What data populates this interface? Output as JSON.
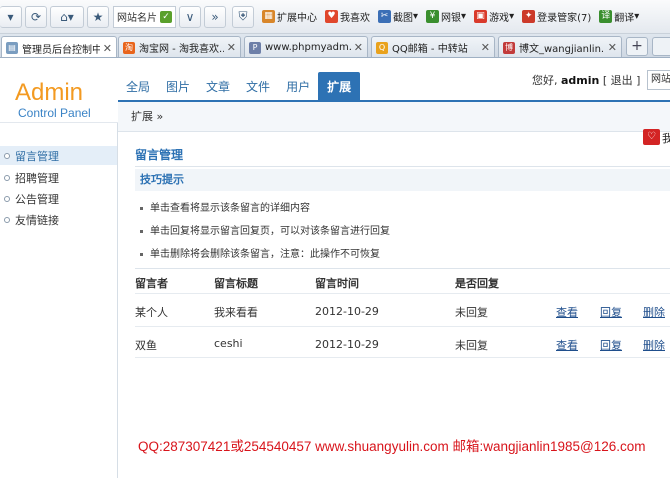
{
  "browser": {
    "address_label": "网站名片",
    "toolbar_links": [
      {
        "label": "扩展中心",
        "icon": "extension-center-icon",
        "color": "#d8862a"
      },
      {
        "label": "我喜欢",
        "icon": "heart-icon",
        "color": "#e0472c"
      },
      {
        "label": "截图",
        "icon": "screenshot-icon",
        "color": "#3b6fb6"
      },
      {
        "label": "网银",
        "icon": "bank-icon",
        "color": "#3a8f2e"
      },
      {
        "label": "游戏",
        "icon": "game-icon",
        "color": "#d93a2b"
      },
      {
        "label": "登录管家(7)",
        "icon": "login-manager-icon",
        "color": "#cc3a2a"
      },
      {
        "label": "翻译",
        "icon": "translate-icon",
        "color": "#3a8f2e"
      }
    ],
    "tabs": [
      {
        "label": "管理员后台控制中...",
        "active": true
      },
      {
        "label": "淘宝网 - 淘我喜欢..."
      },
      {
        "label": "www.phpmyadm..."
      },
      {
        "label": "QQ邮箱 - 中转站"
      },
      {
        "label": "博文_wangjianlin..."
      }
    ],
    "new_tab": "+",
    "right_input": "网站"
  },
  "admin": {
    "logo_main": "Admin",
    "logo_sub": "Control Panel",
    "nav": [
      "全局",
      "图片",
      "文章",
      "文件",
      "用户",
      "扩展"
    ],
    "active_nav": "扩展",
    "user_greeting": "您好,",
    "username": "admin",
    "logout_open": "[",
    "logout": "退出",
    "logout_close": "]",
    "breadcrumb": "扩展 »",
    "sidebar": [
      "留言管理",
      "招聘管理",
      "公告管理",
      "友情链接"
    ],
    "love_badge": "♡",
    "love_text": "我"
  },
  "main": {
    "title": "留言管理",
    "tips_heading": "技巧提示",
    "tips": [
      "单击查看将显示该条留言的详细内容",
      "单击回复将显示留言回复页，可以对该条留言进行回复",
      "单击删除将会删除该条留言，注意：此操作不可恢复"
    ],
    "table": {
      "headers": [
        "留言者",
        "留言标题",
        "留言时间",
        "是否回复"
      ],
      "rows": [
        {
          "author": "某个人",
          "title": "我来看看",
          "date": "2012-10-29",
          "replied": "未回复"
        },
        {
          "author": "双鱼",
          "title": "ceshi",
          "date": "2012-10-29",
          "replied": "未回复"
        }
      ],
      "actions": [
        "查看",
        "回复",
        "删除"
      ]
    },
    "contact": "QQ:287307421或254540457 www.shuangyulin.com 邮箱:wangjianlin1985@126.com"
  },
  "colors": {
    "accent": "#2d72b4",
    "logo_orange": "#f39a21",
    "contact_red": "#d8141b"
  }
}
